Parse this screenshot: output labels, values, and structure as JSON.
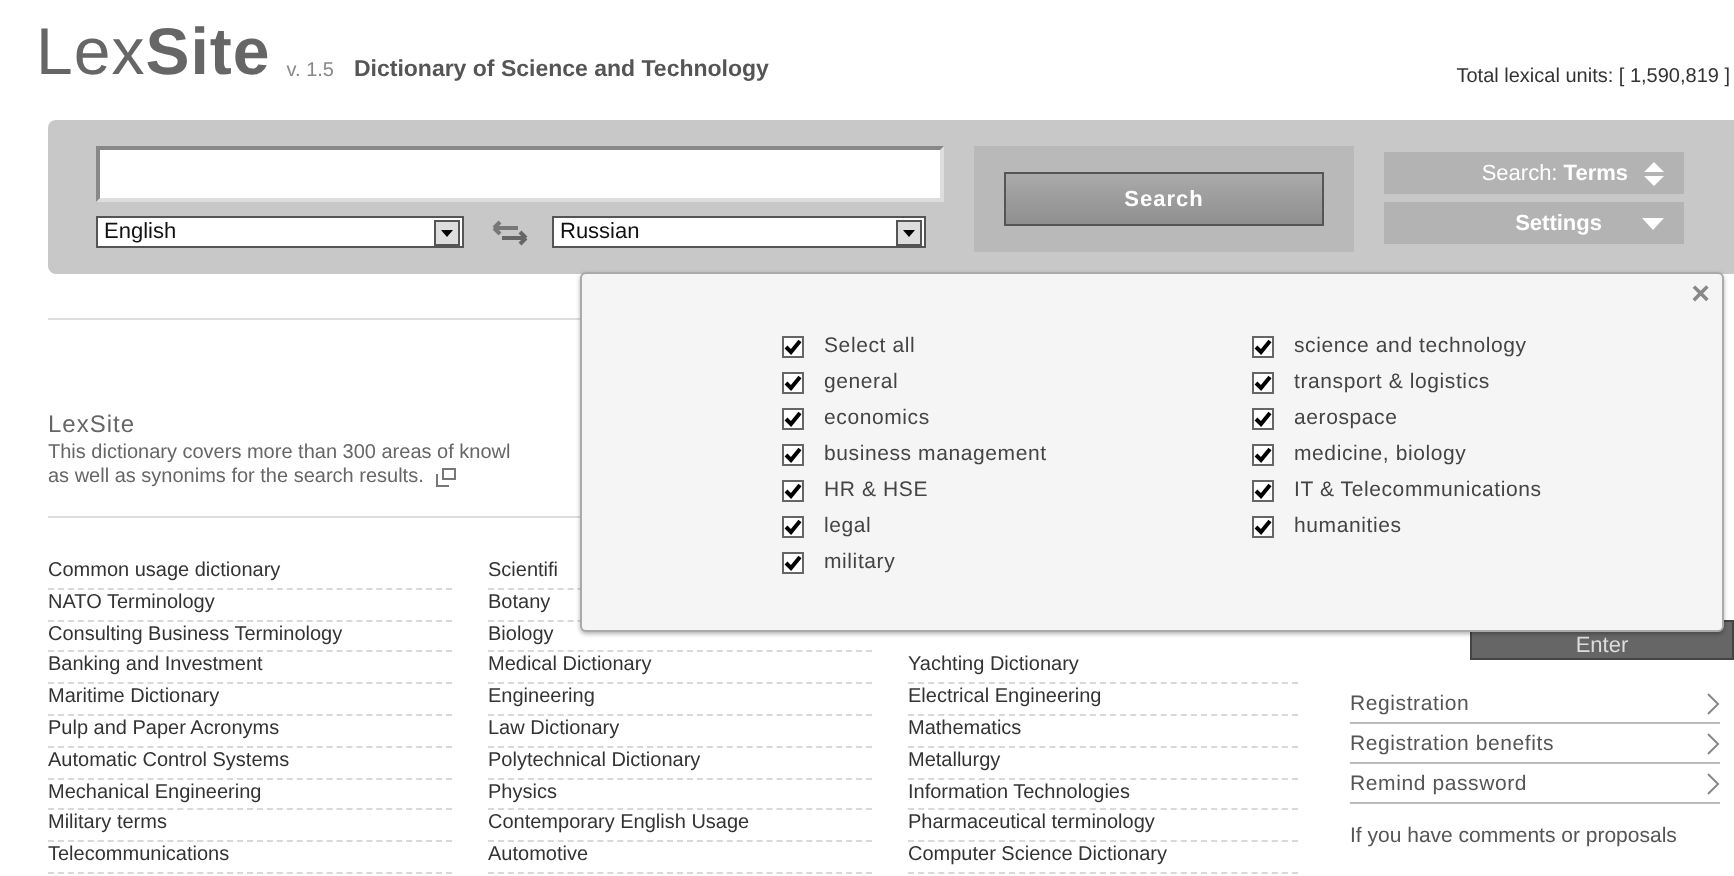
{
  "header": {
    "logo_regular": "Lex",
    "logo_bold": "Site",
    "version": "v. 1.5",
    "tagline": "Dictionary of Science and Technology",
    "total_units": "Total lexical units: [ 1,590,819 ]"
  },
  "search": {
    "source_language": "English",
    "target_language": "Russian",
    "button": "Search",
    "mode": "Search: **Terms**",
    "settings": "Settings"
  },
  "settings_popup": {
    "close": "×",
    "columns": [
      {
        "options": [
          {
            "label": "Select all",
            "checked": true
          },
          {
            "label": "general",
            "checked": true
          },
          {
            "label": "economics",
            "checked": true
          },
          {
            "label": "business management",
            "checked": true
          },
          {
            "label": "HR & HSE",
            "checked": true
          },
          {
            "label": "legal",
            "checked": true
          },
          {
            "label": "military",
            "checked": true
          }
        ]
      },
      {
        "options": [
          {
            "label": "science and technology",
            "checked": true
          },
          {
            "label": "transport & logistics",
            "checked": true
          },
          {
            "label": "aerospace",
            "checked": true
          },
          {
            "label": "medicine, biology",
            "checked": true
          },
          {
            "label": "IT & Telecommunications",
            "checked": true
          },
          {
            "label": "humanities",
            "checked": true
          }
        ]
      }
    ]
  },
  "about": {
    "title": "LexSite",
    "lines": [
      "This dictionary covers more than 300 areas of knowl",
      "as well as synonims for the search results."
    ]
  },
  "dictionaries": {
    "columns": [
      [
        "Common usage dictionary",
        "NATO Terminology",
        "Consulting Business Terminology",
        "Banking and Investment",
        "Maritime Dictionary",
        "Pulp and Paper Acronyms",
        "Automatic Control Systems",
        "Mechanical Engineering",
        "Military terms",
        "Telecommunications"
      ],
      [
        "Scientifi",
        "Botany",
        "Biology",
        "Medical Dictionary",
        "Engineering",
        "Law Dictionary",
        "Polytechnical Dictionary",
        "Physics",
        "Contemporary English Usage",
        "Automotive"
      ],
      [
        "Yachting Dictionary",
        "Electrical Engineering",
        "Mathematics",
        "Metallurgy",
        "Information Technologies",
        "Pharmaceutical terminology",
        "Computer Science Dictionary"
      ]
    ]
  },
  "account": {
    "enter": "Enter",
    "links": [
      "Registration",
      "Registration benefits",
      "Remind password"
    ],
    "note": "If you have comments or proposals"
  }
}
